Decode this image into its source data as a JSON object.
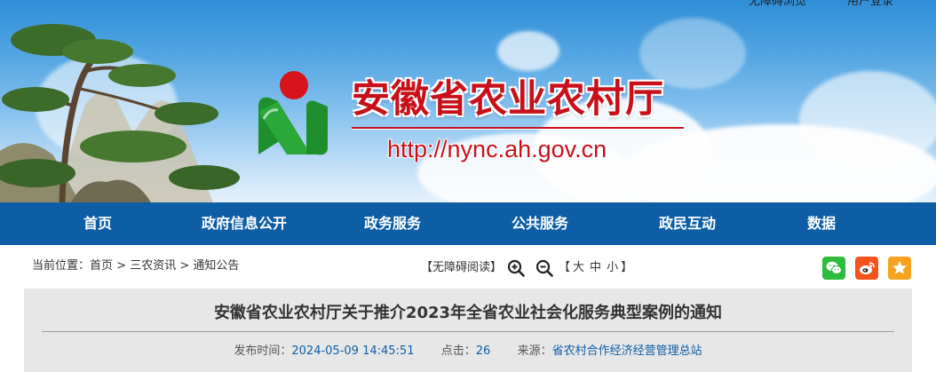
{
  "header": {
    "top_links": [
      "无障碍浏览",
      "用户登录"
    ],
    "site_name": "安徽省农业农村厅",
    "site_url": "http://nync.ah.gov.cn"
  },
  "nav": {
    "items": [
      "首页",
      "政府信息公开",
      "政务服务",
      "公共服务",
      "政民互动",
      "数据"
    ]
  },
  "location": {
    "prefix": "当前位置：",
    "crumbs": [
      "首页",
      "三农资讯",
      "通知公告"
    ],
    "separator": ">"
  },
  "accessibility": {
    "read_label": "【无障碍阅读】",
    "size_open": "【",
    "sizes": [
      "大",
      "中",
      "小"
    ],
    "size_close": "】"
  },
  "share": {
    "icons": [
      "wechat-icon",
      "weibo-icon",
      "favorite-icon"
    ]
  },
  "article": {
    "title": "安徽省农业农村厅关于推介2023年全省农业社会化服务典型案例的通知",
    "publish_label": "发布时间：",
    "publish_time": "2024-05-09 14:45:51",
    "clicks_label": "点击：",
    "clicks": "26",
    "source_label": "来源：",
    "source": "省农村合作经济经营管理总站"
  },
  "colors": {
    "brand_red": "#c8101a",
    "nav_blue": "#0e5ea6",
    "wechat_green": "#2dbb3d",
    "weibo_orange": "#f5531c",
    "favorite_orange": "#f7a21e"
  }
}
